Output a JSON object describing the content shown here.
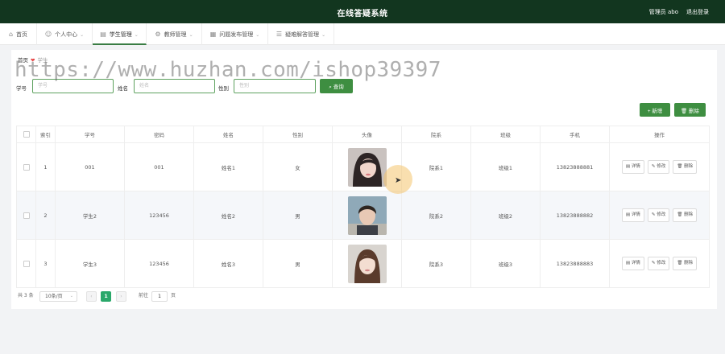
{
  "header": {
    "title": "在线答疑系统",
    "user": "管理员 abo",
    "logout": "退出登录"
  },
  "nav": [
    {
      "label": "首页",
      "icon": "home-icon",
      "glyph": "⌂",
      "chevron": false
    },
    {
      "label": "个人中心",
      "icon": "user-icon",
      "glyph": "☺",
      "chevron": true
    },
    {
      "label": "学生管理",
      "icon": "building-icon",
      "glyph": "▤",
      "chevron": true
    },
    {
      "label": "教师管理",
      "icon": "gear-icon",
      "glyph": "⚙",
      "chevron": true
    },
    {
      "label": "问题发布管理",
      "icon": "doc-icon",
      "glyph": "▦",
      "chevron": true
    },
    {
      "label": "疑难解答管理",
      "icon": "list-icon",
      "glyph": "☰",
      "chevron": true
    }
  ],
  "breadcrumb": {
    "home": "首页",
    "current": "学生"
  },
  "search": {
    "xuehao_label": "学号",
    "xuehao_placeholder": "学号",
    "name_label": "姓名",
    "name_placeholder": "姓名",
    "gender_label": "性别",
    "gender_placeholder": "性别",
    "button": "查询",
    "button_icon": "search-icon"
  },
  "actions": {
    "add": "+ 新增",
    "delete": "删除"
  },
  "table": {
    "headers": [
      "索引",
      "学号",
      "密码",
      "姓名",
      "性别",
      "头像",
      "院系",
      "班级",
      "手机",
      "操作"
    ],
    "rows": [
      {
        "index": "1",
        "xuehao": "001",
        "password": "001",
        "name": "姓名1",
        "gender": "女",
        "dept": "院系1",
        "class": "班级1",
        "phone": "13823888881"
      },
      {
        "index": "2",
        "xuehao": "学生2",
        "password": "123456",
        "name": "姓名2",
        "gender": "男",
        "dept": "院系2",
        "class": "班级2",
        "phone": "13823888882"
      },
      {
        "index": "3",
        "xuehao": "学生3",
        "password": "123456",
        "name": "姓名3",
        "gender": "男",
        "dept": "院系3",
        "class": "班级3",
        "phone": "13823888883"
      }
    ],
    "ops": {
      "detail": "详情",
      "edit": "修改",
      "delete": "删除"
    }
  },
  "pagination": {
    "total": "共 3 条",
    "page_size": "10条/页",
    "current_page": "1",
    "goto_label": "前往",
    "goto_value": "1",
    "page_unit": "页",
    "prev": "‹",
    "next": "›"
  },
  "watermark": "https://www.huzhan.com/ishop39397",
  "colors": {
    "header_bg": "#12361f",
    "accent": "#3e8e41",
    "page_active": "#2aa86a"
  }
}
